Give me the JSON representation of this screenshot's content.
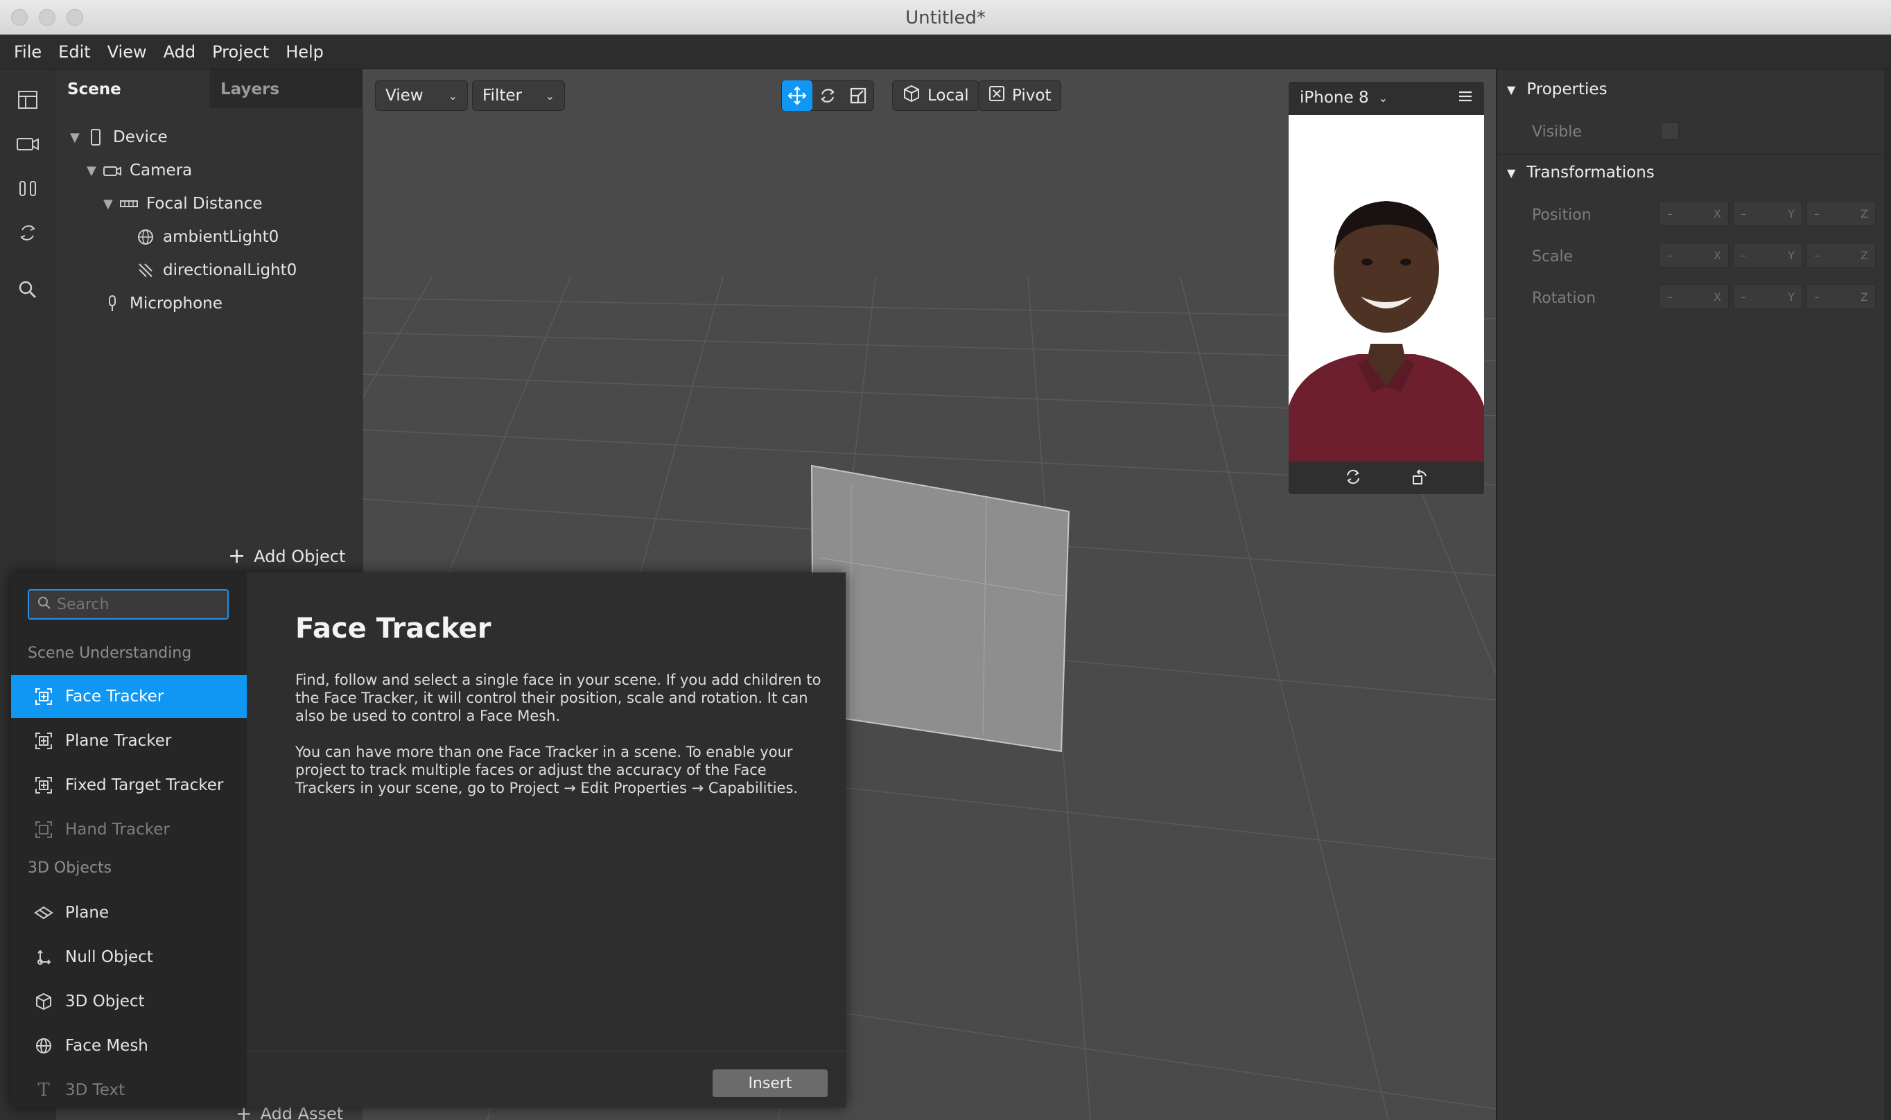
{
  "window": {
    "title": "Untitled*"
  },
  "menubar": [
    "File",
    "Edit",
    "View",
    "Add",
    "Project",
    "Help"
  ],
  "scene_panel": {
    "tabs": [
      "Scene",
      "Layers"
    ],
    "tree": [
      {
        "label": "Device",
        "icon": "phone-icon",
        "expanded": true
      },
      {
        "label": "Camera",
        "icon": "camera-icon",
        "expanded": true
      },
      {
        "label": "Focal Distance",
        "icon": "focal-distance-icon",
        "expanded": true
      },
      {
        "label": "ambientLight0",
        "icon": "ambient-light-icon"
      },
      {
        "label": "directionalLight0",
        "icon": "directional-light-icon"
      },
      {
        "label": "Microphone",
        "icon": "microphone-icon"
      }
    ],
    "add_object": "Add Object",
    "add_asset": "Add Asset"
  },
  "viewport_toolbar": {
    "view": "View",
    "filter": "Filter",
    "local": "Local",
    "pivot": "Pivot"
  },
  "device_preview": {
    "device": "iPhone 8"
  },
  "properties": {
    "section_properties": "Properties",
    "visible_label": "Visible",
    "section_transformations": "Transformations",
    "rows": [
      {
        "label": "Position"
      },
      {
        "label": "Scale"
      },
      {
        "label": "Rotation"
      }
    ],
    "axes": [
      "X",
      "Y",
      "Z"
    ],
    "placeholder": "–"
  },
  "add_popup": {
    "search_placeholder": "Search",
    "categories": [
      "Scene Understanding",
      "3D Objects"
    ],
    "items": [
      {
        "label": "Face Tracker",
        "icon": "face-tracker-icon",
        "selected": true
      },
      {
        "label": "Plane Tracker",
        "icon": "plane-tracker-icon"
      },
      {
        "label": "Fixed Target Tracker",
        "icon": "fixed-target-tracker-icon"
      },
      {
        "label": "Hand Tracker",
        "icon": "hand-tracker-icon",
        "disabled": true
      },
      {
        "label": "Plane",
        "icon": "plane-icon"
      },
      {
        "label": "Null Object",
        "icon": "null-object-icon"
      },
      {
        "label": "3D Object",
        "icon": "cube-icon"
      },
      {
        "label": "Face Mesh",
        "icon": "face-mesh-icon"
      },
      {
        "label": "3D Text",
        "icon": "text-icon",
        "disabled": true
      }
    ],
    "detail": {
      "title": "Face Tracker",
      "p1": "Find, follow and select a single face in your scene. If you add children to the Face Tracker, it will control their position, scale and rotation. It can also be used to control a Face Mesh.",
      "p2": "You can have more than one Face Tracker in a scene. To enable your project to track multiple faces or adjust the accuracy of the Face Trackers in your scene, go to Project → Edit Properties → Capabilities."
    },
    "insert": "Insert"
  },
  "colors": {
    "accent": "#0f97f3",
    "panel": "#333333",
    "viewport": "#4a4a4a"
  }
}
